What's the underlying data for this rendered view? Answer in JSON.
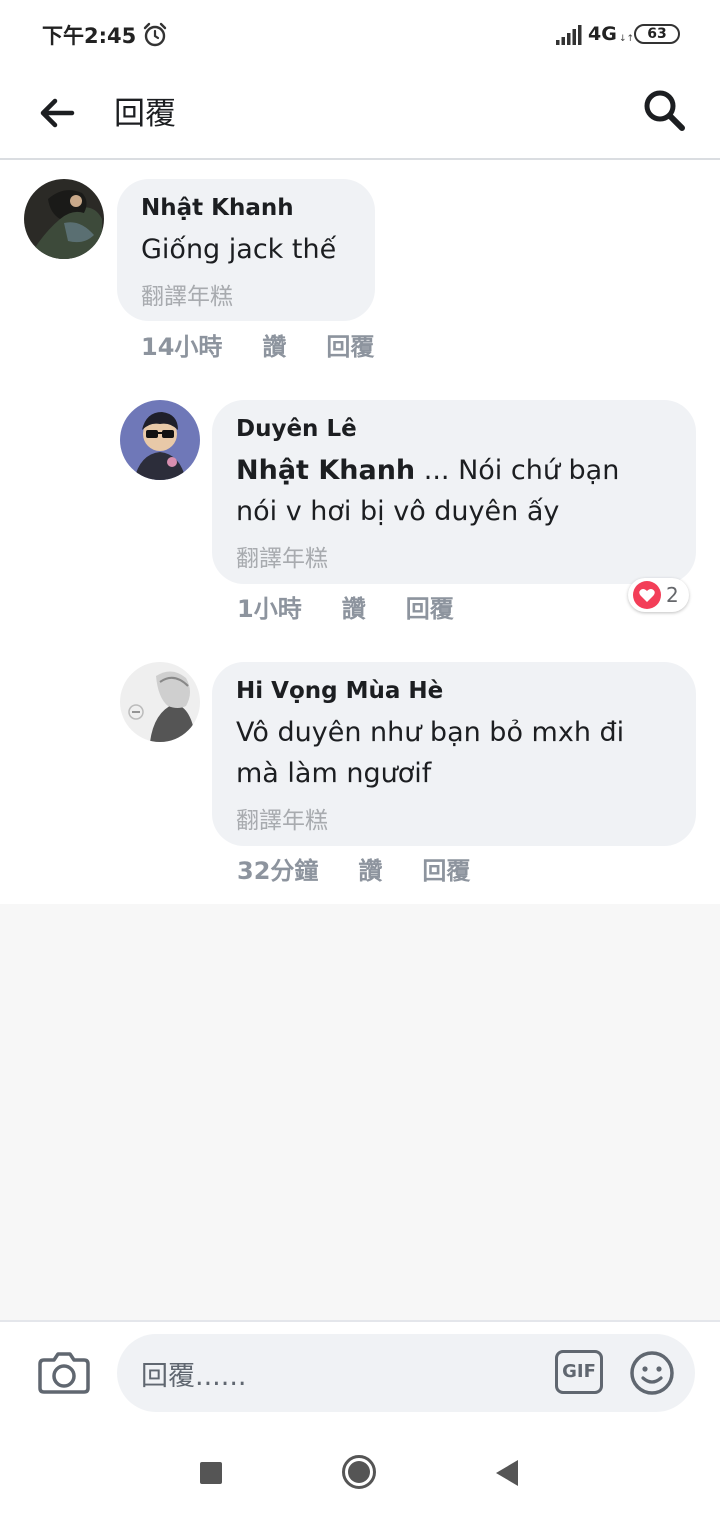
{
  "status_bar": {
    "time": "下午2:45",
    "network": "4G",
    "network_arrows": "↓↑",
    "battery": "63"
  },
  "header": {
    "title": "回覆"
  },
  "comments": [
    {
      "author": "Nhật Khanh",
      "text": "Giống jack thế",
      "translate": "翻譯年糕",
      "time": "14小時",
      "like": "讚",
      "reply": "回覆"
    },
    {
      "author": "Duyên Lê",
      "mention": "Nhật Khanh",
      "text_line1": " ... Nói chứ bạn",
      "text_line2": "nói v hơi bị vô duyên ấy",
      "translate": "翻譯年糕",
      "time": "1小時",
      "like": "讚",
      "reply": "回覆",
      "reaction_count": "2",
      "reaction_icon": "heart-icon",
      "reaction_color": "#f33e58"
    },
    {
      "author": "Hi Vọng Mùa Hè",
      "text_line1": "Vô duyên như bạn bỏ mxh đi",
      "text_line2": "mà làm ngươif",
      "translate": "翻譯年糕",
      "time": "32分鐘",
      "like": "讚",
      "reply": "回覆"
    }
  ],
  "composer": {
    "placeholder": "回覆......",
    "gif_label": "GIF"
  },
  "colors": {
    "bubble": "#f0f2f5",
    "meta_text": "#8d949e",
    "primary_text": "#1c1e21"
  }
}
